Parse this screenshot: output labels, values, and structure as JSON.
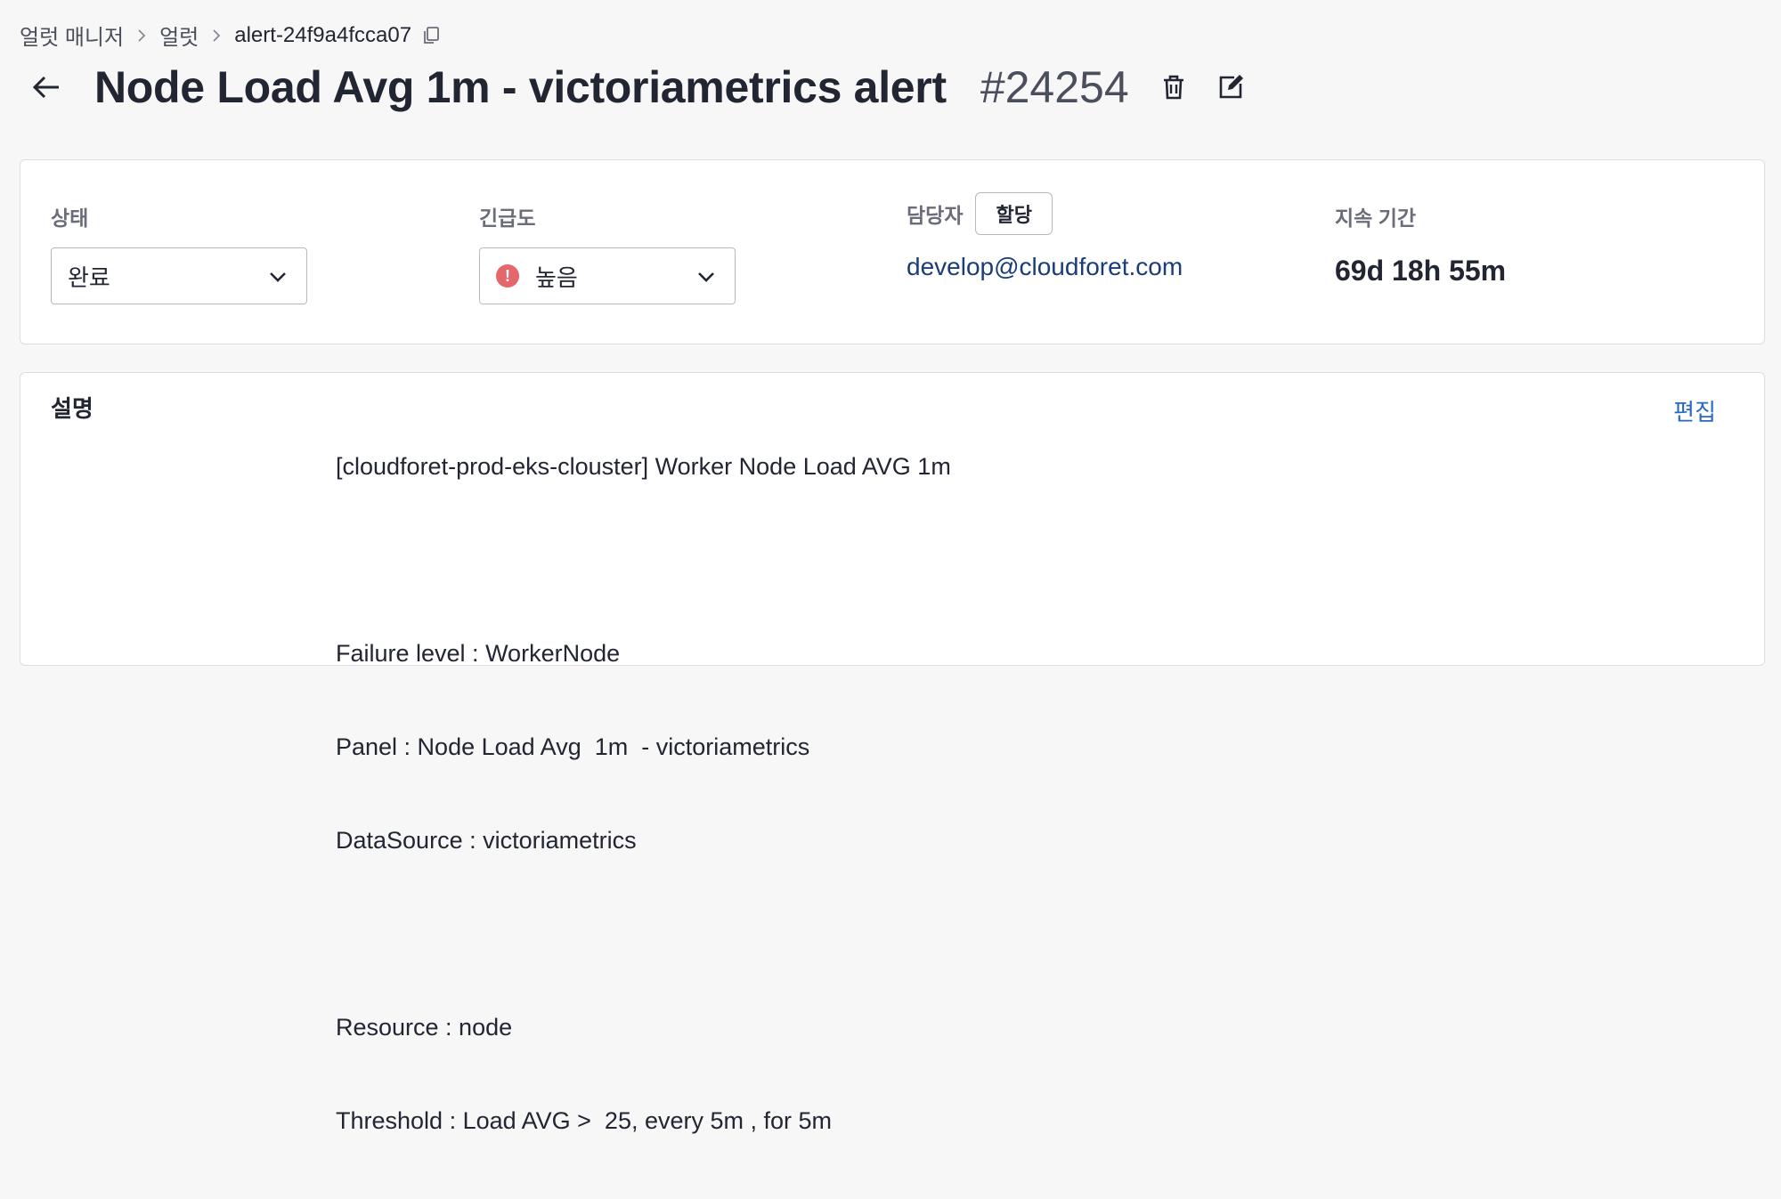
{
  "breadcrumb": {
    "items": [
      "얼럿 매니저",
      "얼럿",
      "alert-24f9a4fcca07"
    ]
  },
  "header": {
    "title": "Node Load Avg 1m - victoriametrics alert",
    "alert_number": "#24254"
  },
  "status": {
    "label": "상태",
    "value": "완료"
  },
  "urgency": {
    "label": "긴급도",
    "value": "높음",
    "icon": "alert-circle-icon",
    "color": "#e5676b"
  },
  "assignee": {
    "label": "담당자",
    "assign_button": "할당",
    "email": "develop@cloudforet.com"
  },
  "duration": {
    "label": "지속 기간",
    "value": "69d 18h 55m"
  },
  "description": {
    "label": "설명",
    "edit_label": "편집",
    "lines": [
      "[cloudforet-prod-eks-clouster] Worker Node Load AVG 1m",
      "",
      "Failure level : WorkerNode",
      "Panel : Node Load Avg  1m  - victoriametrics",
      "DataSource : victoriametrics",
      "",
      "Resource : node",
      "Threshold : Load AVG >  25, every 5m , for 5m"
    ]
  },
  "colors": {
    "background": "#f7f7f7",
    "link": "#2a67c4",
    "email": "#1a3c7a",
    "urgency_high": "#e5676b"
  }
}
